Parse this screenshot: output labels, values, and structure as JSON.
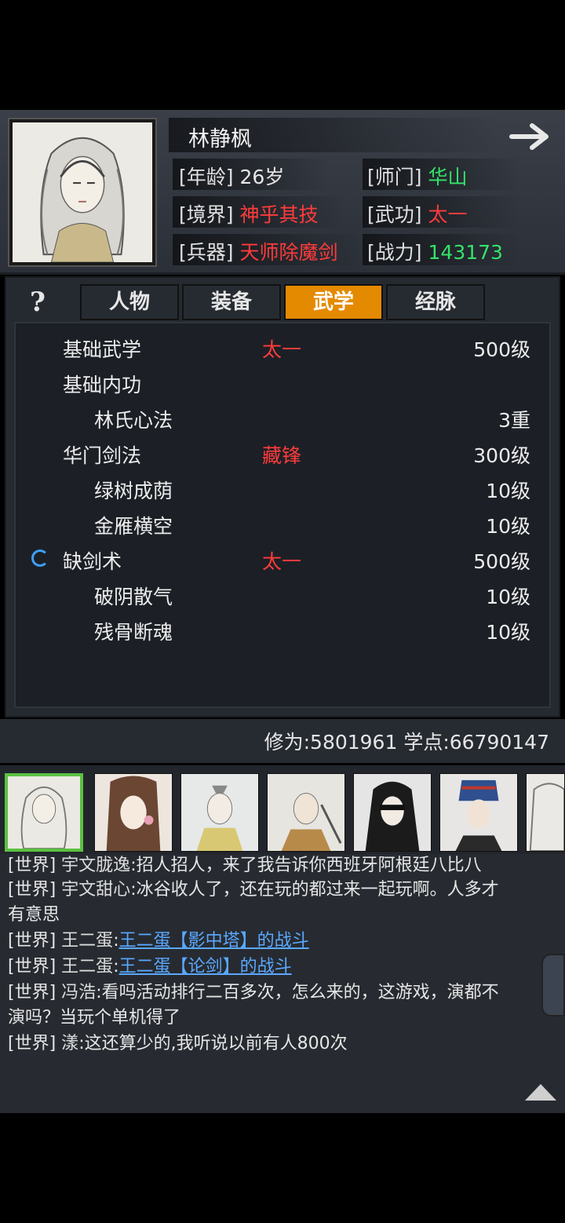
{
  "character": {
    "name": "林静枫",
    "age_label": "[年龄]",
    "age": "26岁",
    "sect_label": "[师门]",
    "sect": "华山",
    "realm_label": "[境界]",
    "realm": "神乎其技",
    "kungfu_label": "[武功]",
    "kungfu": "太一",
    "weapon_label": "[兵器]",
    "weapon": "天师除魔剑",
    "power_label": "[战力]",
    "power": "143173"
  },
  "help_label": "?",
  "tabs": [
    {
      "label": "人物"
    },
    {
      "label": "装备"
    },
    {
      "label": "武学",
      "active": true
    },
    {
      "label": "经脉"
    }
  ],
  "skills": [
    {
      "name": "基础武学",
      "style": "太一",
      "level": "500级"
    },
    {
      "name": "基础内功",
      "style": "",
      "level": ""
    },
    {
      "name": "林氏心法",
      "style": "",
      "level": "3重",
      "sub": true
    },
    {
      "name": "华门剑法",
      "style": "藏锋",
      "level": "300级"
    },
    {
      "name": "绿树成荫",
      "style": "",
      "level": "10级",
      "sub": true
    },
    {
      "name": "金雁横空",
      "style": "",
      "level": "10级",
      "sub": true
    },
    {
      "name": "缺剑术",
      "style": "太一",
      "level": "500级",
      "loading": true
    },
    {
      "name": "破阴散气",
      "style": "",
      "level": "10级",
      "sub": true
    },
    {
      "name": "残骨断魂",
      "style": "",
      "level": "10级",
      "sub": true
    }
  ],
  "stats": {
    "text": "修为:5801961 学点:66790147"
  },
  "chat": [
    {
      "channel": "[世界]",
      "user": "宇文胧逸",
      "text": ":招人招人，来了我告诉你西班牙阿根廷八比八"
    },
    {
      "channel": "[世界]",
      "user": "宇文甜心",
      "text": ":冰谷收人了，还在玩的都过来一起玩啊。人多才"
    },
    {
      "channel": "",
      "user": "",
      "text": "有意思"
    },
    {
      "channel": "[世界]",
      "user": "王二蛋",
      "text": ":",
      "link": "王二蛋【影中塔】的战斗"
    },
    {
      "channel": "[世界]",
      "user": "王二蛋",
      "text": ":",
      "link": "王二蛋【论剑】的战斗"
    },
    {
      "channel": "[世界]",
      "user": "冯浩",
      "text": ":看吗活动排行二百多次，怎么来的，这游戏，演都不"
    },
    {
      "channel": "",
      "user": "",
      "text": "演吗？当玩个单机得了"
    },
    {
      "channel": "[世界]",
      "user": "漾",
      "text": ":这还算少的,我听说以前有人800次"
    }
  ],
  "colors": {
    "accent": "#e48a00",
    "red": "#ff3b3b",
    "green": "#33e36a",
    "link": "#5aa8ff",
    "selected": "#5bc142"
  }
}
